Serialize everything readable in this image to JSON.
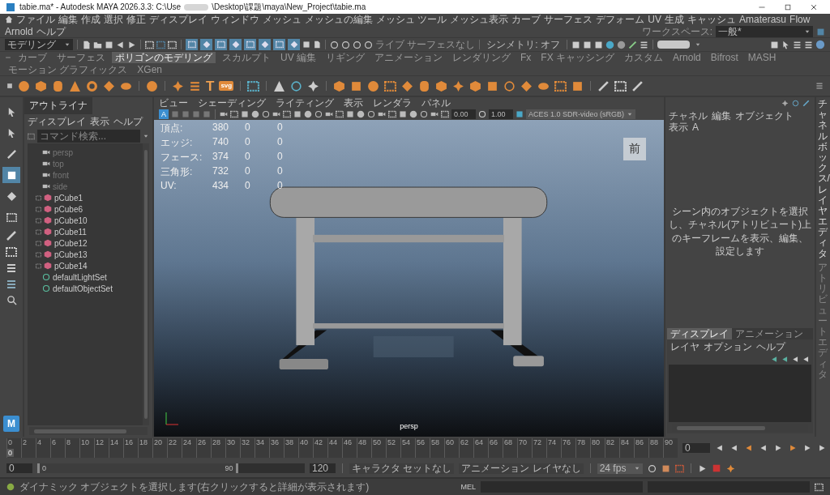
{
  "window": {
    "title_parts": [
      "tabie.ma* - Autodesk MAYA 2026.3.3: C:\\Use",
      "\\Desktop\\課題\\maya\\New_Project\\tabie.ma"
    ]
  },
  "menu_bar": [
    "ファイル",
    "編集",
    "作成",
    "選択",
    "修正",
    "ディスプレイ",
    "ウィンドウ",
    "メッシュ",
    "メッシュの編集",
    "メッシュ ツール",
    "メッシュ表示",
    "カーブ",
    "サーフェス",
    "デフォーム",
    "UV",
    "生成",
    "キャッシュ",
    "Amaterasu",
    "Flow",
    "Arnold",
    "ヘルプ"
  ],
  "workspace": {
    "label": "ワークスペース:",
    "value": "一般*"
  },
  "status_line": {
    "menu_set": "モデリング",
    "snaps": [
      {
        "on": true
      },
      {
        "on": true
      },
      {
        "on": true
      },
      {
        "on": true
      },
      {
        "on": true
      },
      {
        "on": true
      },
      {
        "on": true
      },
      {
        "on": true
      }
    ],
    "live_surface": "ライブ サーフェスなし",
    "symmetry": "シンメトリ: オフ"
  },
  "shelf": {
    "tabs": [
      {
        "label": "カーブ",
        "selected": false
      },
      {
        "label": "サーフェス",
        "selected": false
      },
      {
        "label": "ポリゴンのモデリング",
        "selected": true
      },
      {
        "label": "スカルプト",
        "selected": false
      },
      {
        "label": "UV 編集",
        "selected": false
      },
      {
        "label": "リギング",
        "selected": false
      },
      {
        "label": "アニメーション",
        "selected": false
      },
      {
        "label": "レンダリング",
        "selected": false
      },
      {
        "label": "Fx",
        "selected": false
      },
      {
        "label": "FX キャッシング",
        "selected": false
      },
      {
        "label": "カスタム",
        "selected": false
      },
      {
        "label": "Arnold",
        "selected": false
      },
      {
        "label": "Bifrost",
        "selected": false
      },
      {
        "label": "MASH",
        "selected": false
      },
      {
        "label": "モーション グラフィックス",
        "selected": false
      },
      {
        "label": "XGen",
        "selected": false
      }
    ],
    "type_icon": "T",
    "svg_icon": "svg"
  },
  "toolbox": [
    {
      "selected": false
    },
    {
      "selected": false
    },
    {
      "selected": false
    },
    {
      "selected": true
    },
    {
      "selected": false
    },
    {
      "selected": false
    }
  ],
  "logo": "M",
  "outliner": {
    "title": "アウトライナ",
    "menu": [
      "ディスプレイ",
      "表示",
      "ヘルプ"
    ],
    "placeholder": "コマンド検索...",
    "items": [
      {
        "label": "persp",
        "kind": "camera"
      },
      {
        "label": "top",
        "kind": "camera"
      },
      {
        "label": "front",
        "kind": "camera"
      },
      {
        "label": "side",
        "kind": "camera"
      },
      {
        "label": "pCube1",
        "kind": "mesh"
      },
      {
        "label": "pCube6",
        "kind": "mesh"
      },
      {
        "label": "pCube10",
        "kind": "mesh"
      },
      {
        "label": "pCube11",
        "kind": "mesh"
      },
      {
        "label": "pCube12",
        "kind": "mesh"
      },
      {
        "label": "pCube13",
        "kind": "mesh"
      },
      {
        "label": "pCube14",
        "kind": "mesh"
      },
      {
        "label": "defaultLightSet",
        "kind": "set"
      },
      {
        "label": "defaultObjectSet",
        "kind": "set"
      }
    ]
  },
  "viewport": {
    "menu": [
      "ビュー",
      "シェーディング",
      "ライティング",
      "表示",
      "レンダラ",
      "パネル"
    ],
    "icon_label": "A",
    "exposure": "0.00",
    "gamma": "1.00",
    "color_space": "ACES 1.0 SDR-video (sRGB)",
    "hud": [
      {
        "label": "頂点:",
        "values": [
          "380",
          "0",
          "0"
        ]
      },
      {
        "label": "エッジ:",
        "values": [
          "740",
          "0",
          "0"
        ]
      },
      {
        "label": "フェース:",
        "values": [
          "374",
          "0",
          "0"
        ]
      },
      {
        "label": "三角形:",
        "values": [
          "732",
          "0",
          "0"
        ]
      },
      {
        "label": "UV:",
        "values": [
          "434",
          "0",
          "0"
        ]
      }
    ],
    "view_cube": "前",
    "camera": "persp"
  },
  "channel_box": {
    "menu": [
      "チャネル",
      "編集",
      "オブジェクト",
      "表示",
      "A"
    ],
    "message": "シーン内のオブジェクトを選択し、チャネル(アトリビュート)上のキーフレームを表示、編集、設定します",
    "side_tabs": [
      "チャネルボックス/レイヤエディタ",
      "アトリビュートエディタ"
    ]
  },
  "layer_editor": {
    "tabs": [
      {
        "label": "ディスプレイ",
        "selected": true
      },
      {
        "label": "アニメーション",
        "selected": false
      }
    ],
    "menu": [
      "レイヤ",
      "オプション",
      "ヘルプ"
    ]
  },
  "time_slider": {
    "ticks": [
      "0",
      "2",
      "4",
      "6",
      "8",
      "10",
      "12",
      "14",
      "16",
      "18",
      "20",
      "22",
      "24",
      "26",
      "28",
      "30",
      "32",
      "34",
      "36",
      "38",
      "40",
      "42",
      "44",
      "46",
      "48",
      "50",
      "52",
      "54",
      "56",
      "58",
      "60",
      "62",
      "64",
      "66",
      "68",
      "70",
      "72",
      "74",
      "76",
      "78",
      "80",
      "82",
      "84",
      "86",
      "88",
      "90"
    ],
    "current_frame": "0",
    "level": 0,
    "frame_field": "0"
  },
  "range_slider": {
    "start": "0",
    "range_start": "0",
    "range_end": "90",
    "level": 0.75,
    "end": "120",
    "character_set": "キャラクタ セットなし",
    "anim_layer": "アニメーション レイヤなし",
    "fps": "24 fps"
  },
  "command_line": {
    "help": "ダイナミック オブジェクトを選択します(右クリックすると詳細が表示されます)",
    "language": "MEL"
  }
}
